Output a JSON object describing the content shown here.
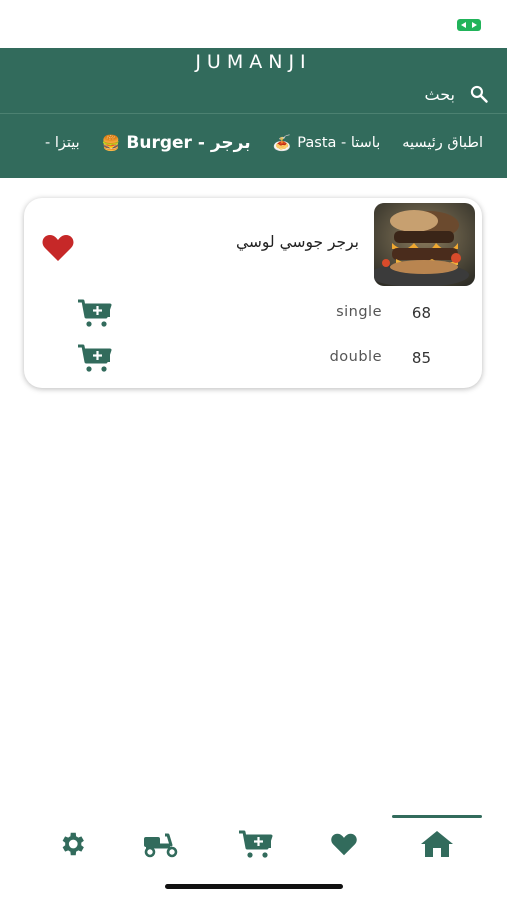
{
  "app": {
    "title": "JUMANJI"
  },
  "search": {
    "label": "بحث"
  },
  "categories": [
    {
      "label": "اطباق رئيسيه",
      "emoji": ""
    },
    {
      "label": "باستا - Pasta",
      "emoji": "🍝"
    },
    {
      "label": "برجر - Burger",
      "emoji": "🍔"
    },
    {
      "label": "بيتزا -",
      "emoji": ""
    }
  ],
  "active_category_index": 2,
  "product": {
    "name": "برجر جوسي لوسي",
    "variants": [
      {
        "label": "single",
        "price": "68"
      },
      {
        "label": "double",
        "price": "85"
      }
    ]
  },
  "colors": {
    "primary": "#326b5c",
    "heart": "#c62828",
    "badge": "#21b35a"
  },
  "bottom_nav": [
    {
      "name": "home",
      "icon": "home-icon",
      "active": true
    },
    {
      "name": "favorites",
      "icon": "heart-icon",
      "active": false
    },
    {
      "name": "cart",
      "icon": "cart-plus-icon",
      "active": false
    },
    {
      "name": "delivery",
      "icon": "scooter-icon",
      "active": false
    },
    {
      "name": "settings",
      "icon": "gear-icon",
      "active": false
    }
  ]
}
